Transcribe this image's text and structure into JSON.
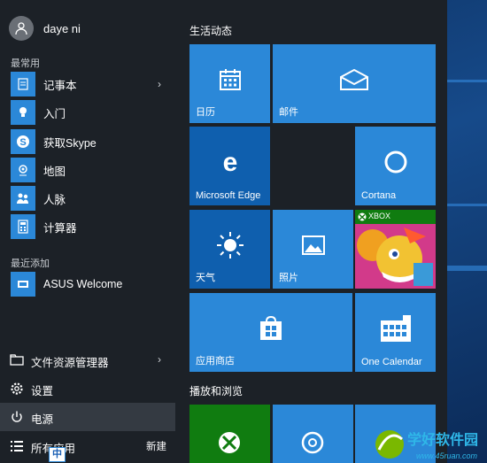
{
  "user": {
    "name": "daye ni"
  },
  "sections": {
    "most_used": "最常用",
    "recently_added": "最近添加"
  },
  "apps": [
    {
      "label": "记事本",
      "icon": "notepad-icon",
      "has_arrow": true
    },
    {
      "label": "入门",
      "icon": "lightbulb-icon",
      "has_arrow": false
    },
    {
      "label": "获取Skype",
      "icon": "skype-icon",
      "has_arrow": false
    },
    {
      "label": "地图",
      "icon": "maps-icon",
      "has_arrow": false
    },
    {
      "label": "人脉",
      "icon": "people-icon",
      "has_arrow": false
    },
    {
      "label": "计算器",
      "icon": "calculator-icon",
      "has_arrow": false
    }
  ],
  "recent": [
    {
      "label": "ASUS Welcome",
      "icon": "asus-icon"
    }
  ],
  "system": [
    {
      "label": "文件资源管理器",
      "icon": "folder-icon",
      "has_arrow": true
    },
    {
      "label": "设置",
      "icon": "gear-icon"
    },
    {
      "label": "电源",
      "icon": "power-icon"
    },
    {
      "label": "所有应用",
      "icon": "list-icon"
    }
  ],
  "new_badge": "新建",
  "ime": "中",
  "groups": {
    "life": "生活动态",
    "play": "播放和浏览"
  },
  "tiles": {
    "calendar": "日历",
    "mail": "邮件",
    "edge": "Microsoft Edge",
    "cortana": "Cortana",
    "weather": "天气",
    "photos": "照片",
    "xbox_badge": "XBOX",
    "store": "应用商店",
    "onecalendar": "One Calendar"
  },
  "colors": {
    "accent": "#2b88d8",
    "accent_dark": "#0f5fae",
    "xbox_green": "#107c10",
    "menu_bg": "#1c2127"
  }
}
